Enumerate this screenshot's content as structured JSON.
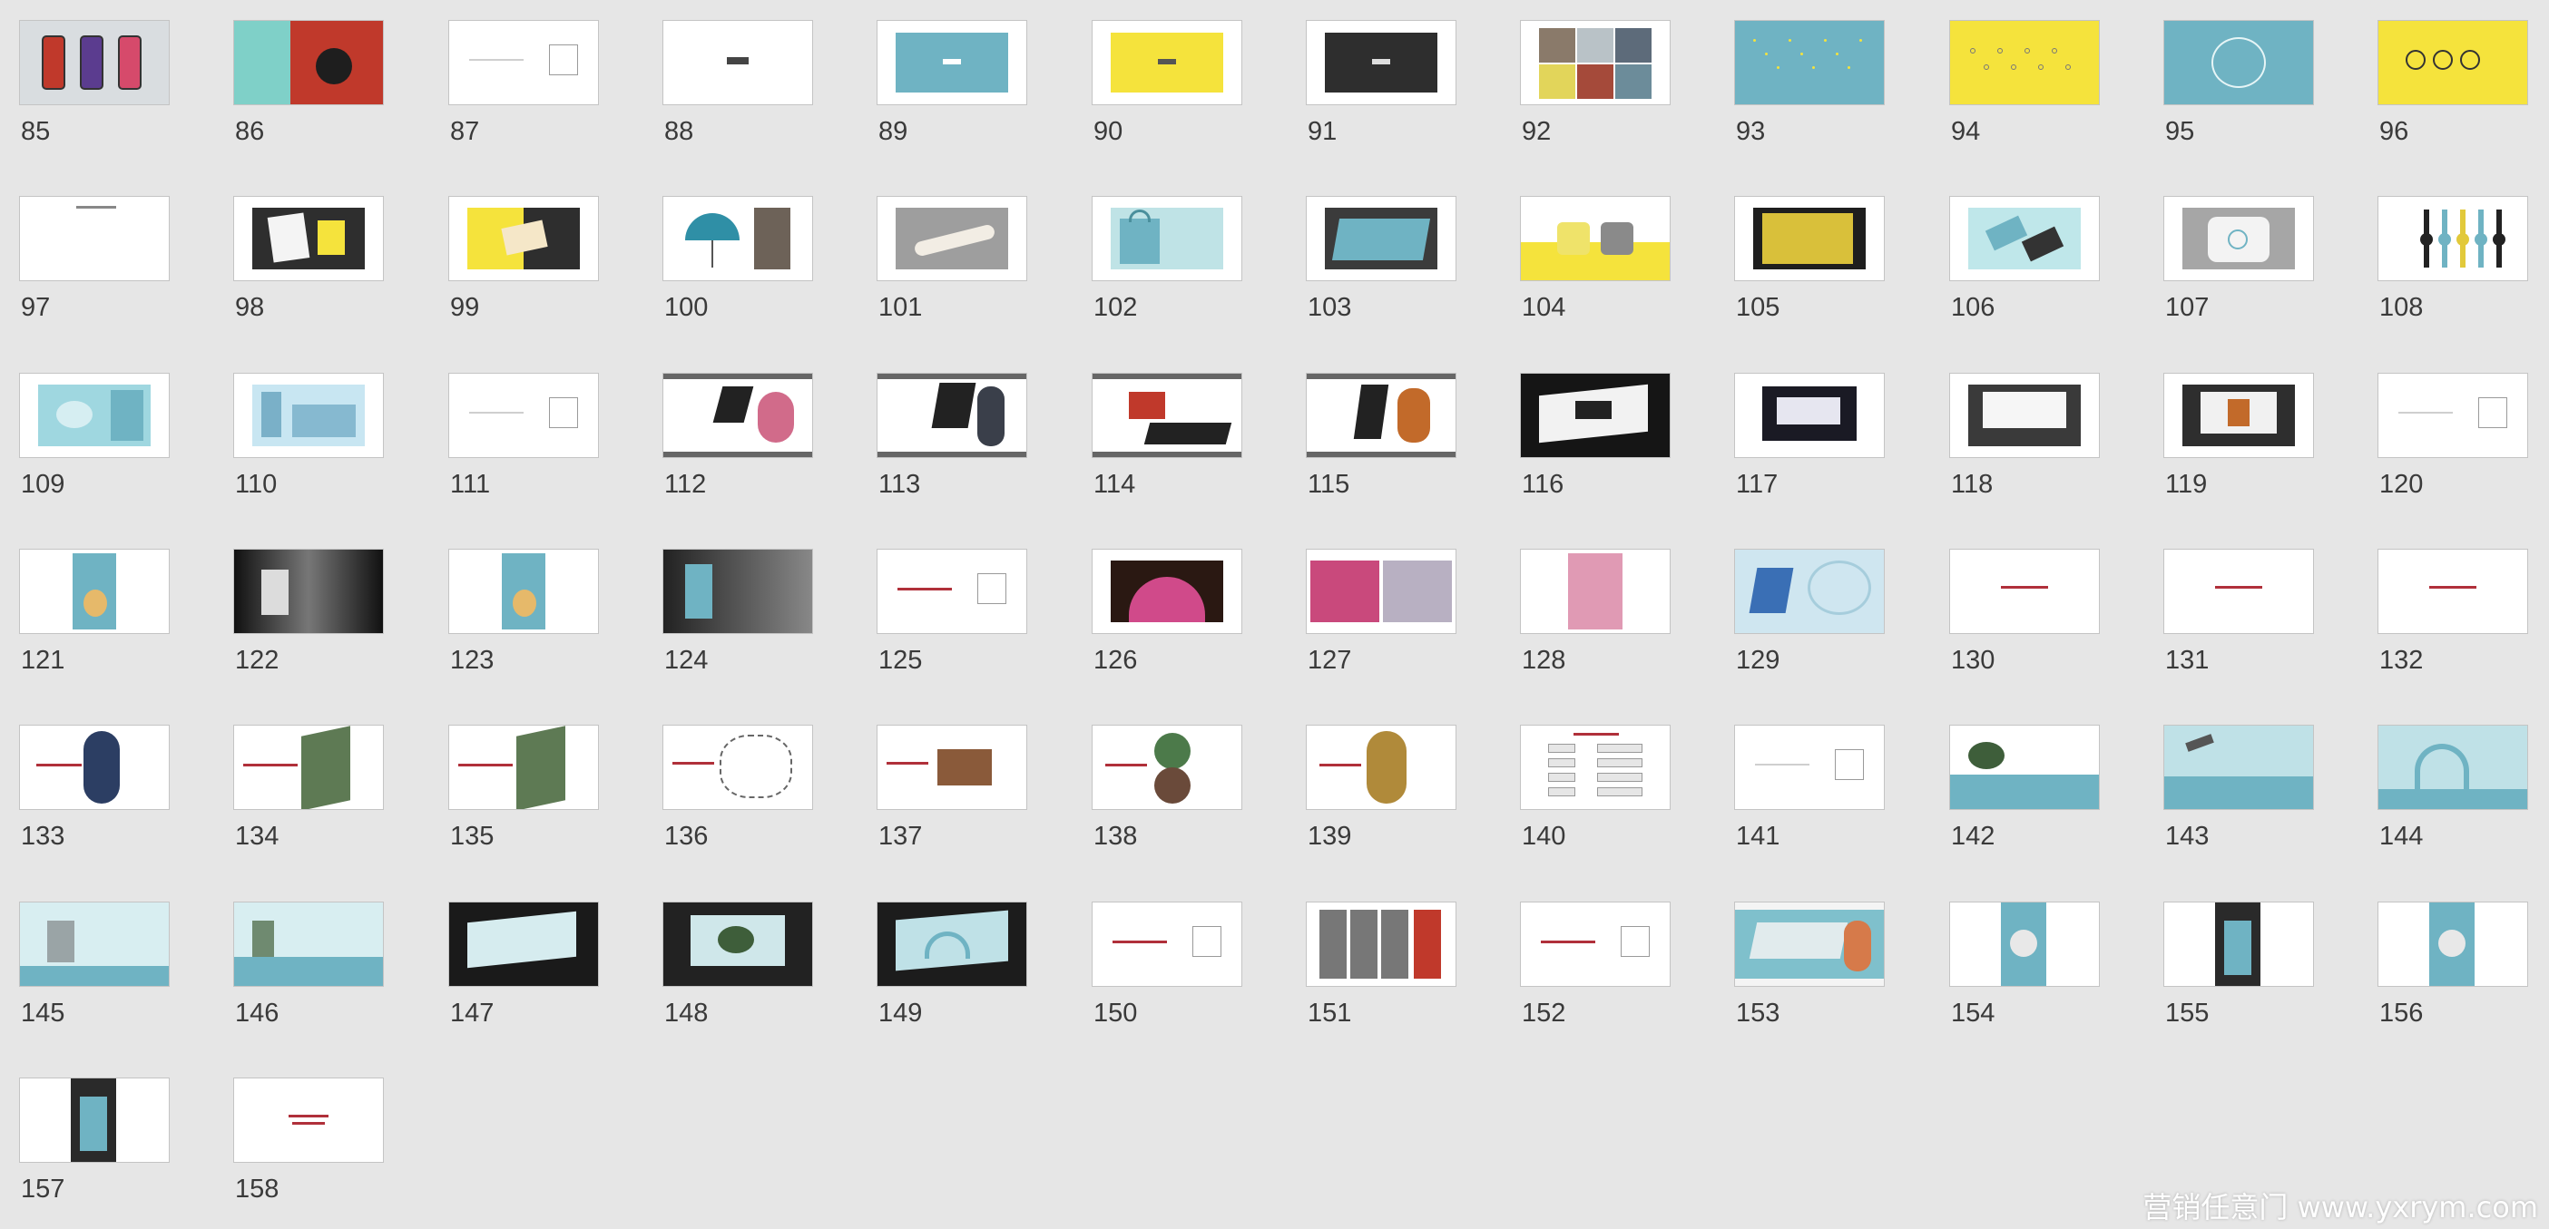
{
  "colors": {
    "page_background": "#e6e6e6",
    "slide_border": "#c4c4c4",
    "number_text": "#3a3a3a",
    "teal": "#6fb3c3",
    "yellow": "#f5e33c",
    "dark": "#2e2e2e",
    "red_text": "#b0303a"
  },
  "slide_grid": {
    "columns": 12,
    "slides": [
      {
        "number": "85",
        "theme": "phones",
        "icon": "phone-cases-thumbnail"
      },
      {
        "number": "86",
        "theme": "collage-teal-red",
        "icon": "collage-thumbnail"
      },
      {
        "number": "87",
        "theme": "blank-box-right",
        "icon": "text-slide-thumbnail"
      },
      {
        "number": "88",
        "theme": "white-logo",
        "icon": "logo-slide-thumbnail"
      },
      {
        "number": "89",
        "theme": "teal-panel",
        "icon": "teal-logo-thumbnail"
      },
      {
        "number": "90",
        "theme": "yellow-panel",
        "icon": "yellow-logo-thumbnail"
      },
      {
        "number": "91",
        "theme": "dark-panel",
        "icon": "dark-logo-thumbnail"
      },
      {
        "number": "92",
        "theme": "photo-collage",
        "icon": "photo-collage-thumbnail"
      },
      {
        "number": "93",
        "theme": "teal-full",
        "icon": "teal-pattern-thumbnail"
      },
      {
        "number": "94",
        "theme": "yellow-full",
        "icon": "yellow-pattern-thumbnail"
      },
      {
        "number": "95",
        "theme": "teal-lines",
        "icon": "teal-lineart-thumbnail"
      },
      {
        "number": "96",
        "theme": "yellow-icons",
        "icon": "yellow-icons-thumbnail"
      },
      {
        "number": "97",
        "theme": "white-title",
        "icon": "text-slide-thumbnail"
      },
      {
        "number": "98",
        "theme": "stationery-dark",
        "icon": "stationery-thumbnail"
      },
      {
        "number": "99",
        "theme": "yellow-dark-hand",
        "icon": "card-thumbnail"
      },
      {
        "number": "100",
        "theme": "umbrella",
        "icon": "umbrella-thumbnail"
      },
      {
        "number": "101",
        "theme": "scroll-grey",
        "icon": "scroll-thumbnail"
      },
      {
        "number": "102",
        "theme": "tote-teal",
        "icon": "tote-bag-thumbnail"
      },
      {
        "number": "103",
        "theme": "box-dark",
        "icon": "gift-box-thumbnail"
      },
      {
        "number": "104",
        "theme": "pillows-yellow",
        "icon": "pillow-thumbnail"
      },
      {
        "number": "105",
        "theme": "yellow-book-dark",
        "icon": "notebook-thumbnail"
      },
      {
        "number": "106",
        "theme": "cards-teal",
        "icon": "business-card-thumbnail"
      },
      {
        "number": "107",
        "theme": "pillow-grey",
        "icon": "cushion-thumbnail"
      },
      {
        "number": "108",
        "theme": "watches",
        "icon": "watch-thumbnail"
      },
      {
        "number": "109",
        "theme": "teal-mockup",
        "icon": "teal-mockup-thumbnail"
      },
      {
        "number": "110",
        "theme": "blue-mockup",
        "icon": "blue-mockup-thumbnail"
      },
      {
        "number": "111",
        "theme": "blank-box-right",
        "icon": "text-slide-thumbnail"
      },
      {
        "number": "112",
        "theme": "ink-poster",
        "icon": "poster-thumbnail"
      },
      {
        "number": "113",
        "theme": "ink-poster-2",
        "icon": "poster-thumbnail"
      },
      {
        "number": "114",
        "theme": "ink-poster-3",
        "icon": "poster-thumbnail"
      },
      {
        "number": "115",
        "theme": "ink-poster-4",
        "icon": "poster-thumbnail"
      },
      {
        "number": "116",
        "theme": "billboard-dark",
        "icon": "billboard-thumbnail"
      },
      {
        "number": "117",
        "theme": "billboard-night",
        "icon": "billboard-thumbnail"
      },
      {
        "number": "118",
        "theme": "billboard-street",
        "icon": "billboard-thumbnail"
      },
      {
        "number": "119",
        "theme": "billboard-station",
        "icon": "billboard-thumbnail"
      },
      {
        "number": "120",
        "theme": "blank-box-right",
        "icon": "text-slide-thumbnail"
      },
      {
        "number": "121",
        "theme": "teal-vertical",
        "icon": "vertical-poster-thumbnail"
      },
      {
        "number": "122",
        "theme": "subway-dark",
        "icon": "subway-thumbnail"
      },
      {
        "number": "123",
        "theme": "teal-vertical",
        "icon": "vertical-poster-thumbnail"
      },
      {
        "number": "124",
        "theme": "station-grey",
        "icon": "station-thumbnail"
      },
      {
        "number": "125",
        "theme": "red-text-box",
        "icon": "text-slide-thumbnail"
      },
      {
        "number": "126",
        "theme": "pink-dome",
        "icon": "dome-thumbnail"
      },
      {
        "number": "127",
        "theme": "pink-collage",
        "icon": "pink-collage-thumbnail"
      },
      {
        "number": "128",
        "theme": "pink-portrait",
        "icon": "portrait-thumbnail"
      },
      {
        "number": "129",
        "theme": "light-teal-art",
        "icon": "pattern-thumbnail"
      },
      {
        "number": "130",
        "theme": "white-red-line",
        "icon": "text-slide-thumbnail"
      },
      {
        "number": "131",
        "theme": "white-red-line",
        "icon": "text-slide-thumbnail"
      },
      {
        "number": "132",
        "theme": "white-red-line",
        "icon": "text-slide-thumbnail"
      },
      {
        "number": "133",
        "theme": "circle-photo",
        "icon": "circle-photo-thumbnail"
      },
      {
        "number": "134",
        "theme": "green-facade",
        "icon": "facade-thumbnail"
      },
      {
        "number": "135",
        "theme": "green-facade",
        "icon": "facade-thumbnail"
      },
      {
        "number": "136",
        "theme": "sketch",
        "icon": "sketch-thumbnail"
      },
      {
        "number": "137",
        "theme": "interior",
        "icon": "interior-thumbnail"
      },
      {
        "number": "138",
        "theme": "circle-photo-2",
        "icon": "circle-photo-thumbnail"
      },
      {
        "number": "139",
        "theme": "circle-photo-3",
        "icon": "circle-photo-thumbnail"
      },
      {
        "number": "140",
        "theme": "diagram",
        "icon": "diagram-thumbnail"
      },
      {
        "number": "141",
        "theme": "blank-box-right",
        "icon": "text-slide-thumbnail"
      },
      {
        "number": "142",
        "theme": "teal-tree",
        "icon": "teal-landscape-thumbnail"
      },
      {
        "number": "143",
        "theme": "teal-crane",
        "icon": "teal-landscape-thumbnail"
      },
      {
        "number": "144",
        "theme": "teal-arch",
        "icon": "teal-landscape-thumbnail"
      },
      {
        "number": "145",
        "theme": "teal-scene",
        "icon": "teal-landscape-thumbnail"
      },
      {
        "number": "146",
        "theme": "teal-scene-2",
        "icon": "teal-landscape-thumbnail"
      },
      {
        "number": "147",
        "theme": "billboard-teal",
        "icon": "billboard-thumbnail"
      },
      {
        "number": "148",
        "theme": "billboard-teal-2",
        "icon": "billboard-thumbnail"
      },
      {
        "number": "149",
        "theme": "billboard-teal-3",
        "icon": "billboard-thumbnail"
      },
      {
        "number": "150",
        "theme": "red-text-box",
        "icon": "text-slide-thumbnail"
      },
      {
        "number": "151",
        "theme": "grey-panels",
        "icon": "panels-thumbnail"
      },
      {
        "number": "152",
        "theme": "red-text-box",
        "icon": "text-slide-thumbnail"
      },
      {
        "number": "153",
        "theme": "teal-calligraphy",
        "icon": "calligraphy-thumbnail"
      },
      {
        "number": "154",
        "theme": "teal-vertical-2",
        "icon": "vertical-poster-thumbnail"
      },
      {
        "number": "155",
        "theme": "dark-vertical",
        "icon": "vertical-poster-thumbnail"
      },
      {
        "number": "156",
        "theme": "teal-vertical-2",
        "icon": "vertical-poster-thumbnail"
      },
      {
        "number": "157",
        "theme": "dark-vertical",
        "icon": "vertical-poster-thumbnail"
      },
      {
        "number": "158",
        "theme": "red-center",
        "icon": "text-slide-thumbnail"
      }
    ]
  },
  "watermark": {
    "text": "营销任意门 www.yxrym.com"
  }
}
